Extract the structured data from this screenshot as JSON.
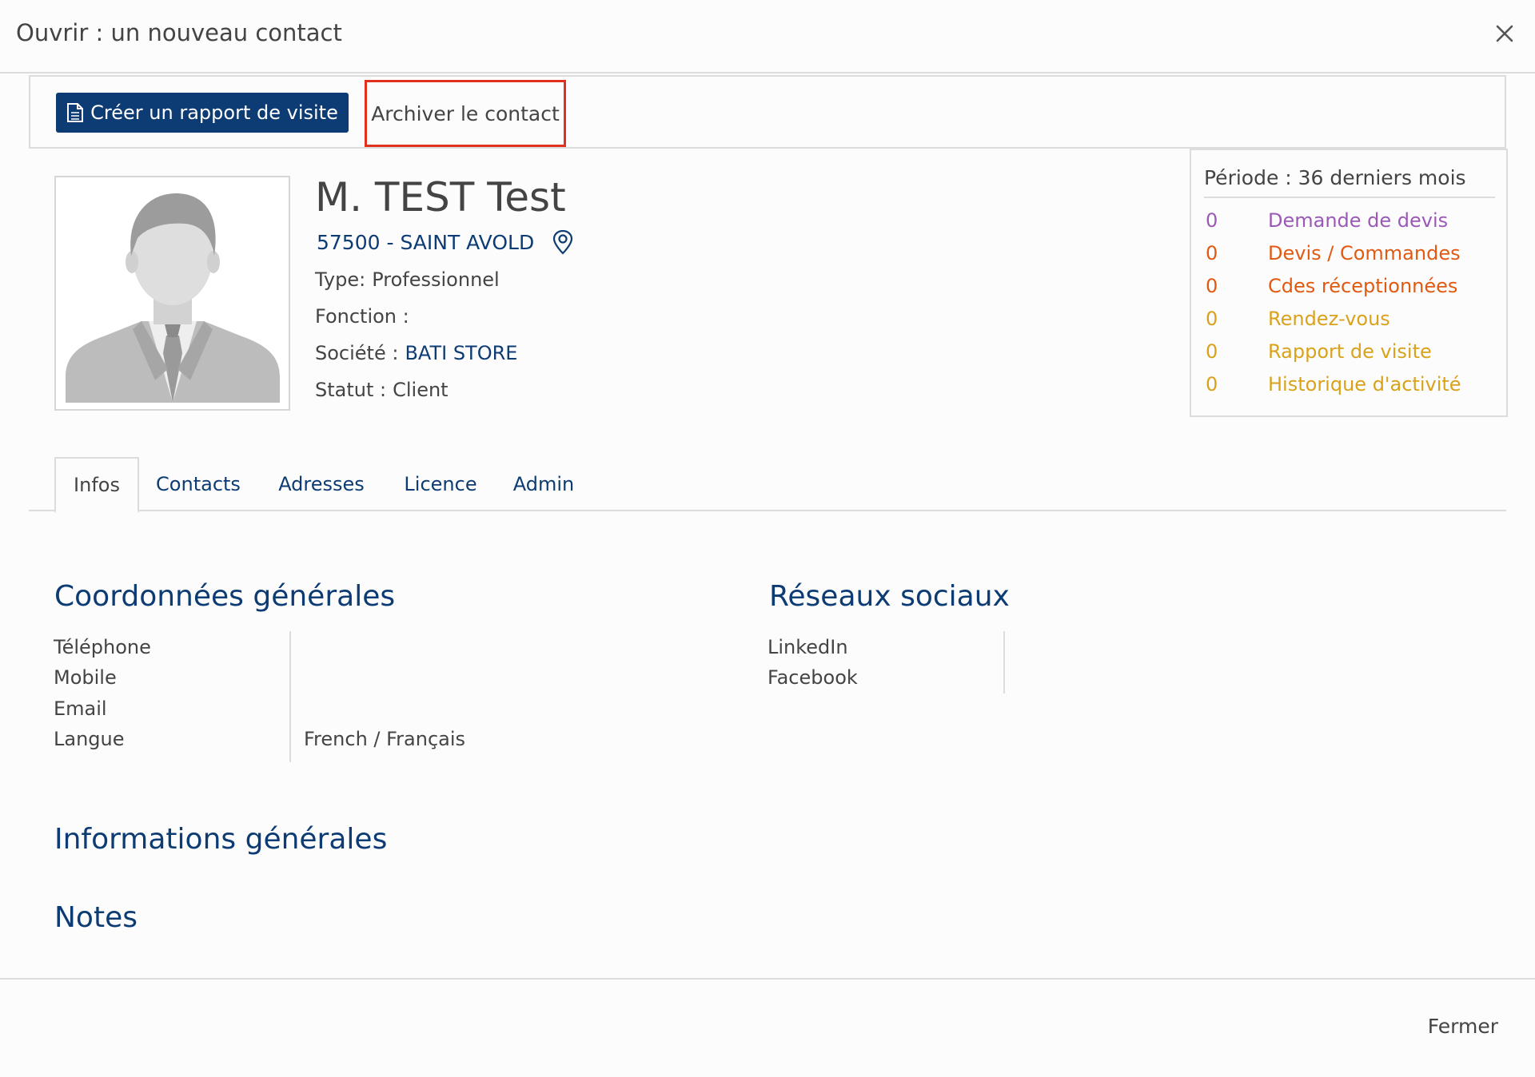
{
  "header": {
    "title": "Ouvrir : un nouveau contact",
    "close_icon": "close-icon"
  },
  "toolbar": {
    "create_report_label": "Créer un rapport de visite",
    "archive_label": "Archiver le contact"
  },
  "contact": {
    "name": "M. TEST Test",
    "city": "57500 - SAINT AVOLD",
    "type_label": "Type:",
    "type_value": "Professionnel",
    "function_label": "Fonction :",
    "function_value": "",
    "company_label": "Société :",
    "company_value": "BATI STORE",
    "status_label": "Statut :",
    "status_value": "Client"
  },
  "stats": {
    "period": "Période : 36 derniers mois",
    "items": [
      {
        "count": "0",
        "label": "Demande de devis",
        "color": "#9b59b6"
      },
      {
        "count": "0",
        "label": "Devis / Commandes",
        "color": "#e05a12"
      },
      {
        "count": "0",
        "label": "Cdes réceptionnées",
        "color": "#e05a12"
      },
      {
        "count": "0",
        "label": "Rendez-vous",
        "color": "#d9a21b"
      },
      {
        "count": "0",
        "label": "Rapport de visite",
        "color": "#d9a21b"
      },
      {
        "count": "0",
        "label": "Historique d'activité",
        "color": "#d9a21b"
      }
    ]
  },
  "tabs": [
    {
      "label": "Infos",
      "active": true
    },
    {
      "label": "Contacts"
    },
    {
      "label": "Adresses"
    },
    {
      "label": "Licence"
    },
    {
      "label": "Admin"
    }
  ],
  "coordonnees": {
    "title": "Coordonnées générales",
    "rows": [
      {
        "label": "Téléphone",
        "value": ""
      },
      {
        "label": "Mobile",
        "value": ""
      },
      {
        "label": "Email",
        "value": ""
      },
      {
        "label": "Langue",
        "value": "French / Français"
      }
    ]
  },
  "reseaux": {
    "title": "Réseaux sociaux",
    "rows": [
      {
        "label": "LinkedIn",
        "value": ""
      },
      {
        "label": "Facebook",
        "value": ""
      }
    ]
  },
  "informations": {
    "title": "Informations générales"
  },
  "notes": {
    "title": "Notes"
  },
  "footer": {
    "close_label": "Fermer"
  },
  "colors": {
    "primary": "#0d3b73",
    "highlight": "#e0301e"
  }
}
